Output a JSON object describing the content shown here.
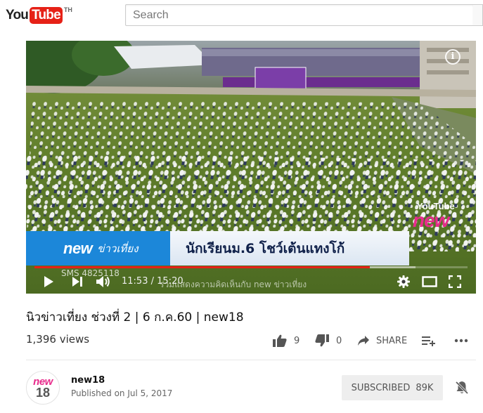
{
  "masthead": {
    "logo_you": "You",
    "logo_tube": "Tube",
    "logo_country": "TH",
    "search_placeholder": "Search"
  },
  "player": {
    "news_brand": "new",
    "news_program": "ข่าวเที่ยง",
    "headline": "นักเรียนม.6 โชว์เต้นแทงโก้",
    "corner_logo_text": "new",
    "corner_logo_yt": "YouTube",
    "sms_caption": "SMS 4825118",
    "ticker_text": "ร่วมแสดงความคิดเห็นกับ new ข่าวเที่ยง",
    "current_time": "11:53",
    "time_separator": "/",
    "duration": "15:20",
    "played_fraction": 0.775,
    "loaded_fraction": 0.88
  },
  "video": {
    "title": "นิวข่าวเที่ยง ช่วงที่ 2 | 6 ก.ค.60 | new18",
    "views": "1,396 views",
    "likes": "9",
    "dislikes": "0",
    "share_label": "SHARE"
  },
  "channel": {
    "avatar_top": "new",
    "avatar_bottom": "18",
    "name": "new18",
    "published": "Published on Jul 5, 2017",
    "subscribe_label": "SUBSCRIBED",
    "subscriber_count": "89K"
  },
  "colors": {
    "brand_red": "#e62117",
    "news_blue": "#1c87d9",
    "new18_pink": "#e82b8c",
    "field_green": "#5f7d2a"
  }
}
